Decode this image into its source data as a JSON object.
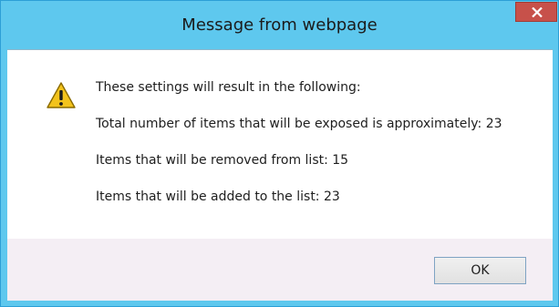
{
  "window": {
    "title": "Message from webpage",
    "close_icon": "close-icon"
  },
  "message": {
    "icon": "warning-icon",
    "lines": [
      "These settings will result in the following:",
      "Total number of items that will be exposed is approximately: 23",
      "Items that will be removed from list: 15",
      "Items that will be added to the list: 23"
    ]
  },
  "buttons": {
    "ok_label": "OK"
  },
  "colors": {
    "title_bar": "#5ec8ee",
    "close_button": "#c7514a",
    "footer": "#f4eef4"
  }
}
